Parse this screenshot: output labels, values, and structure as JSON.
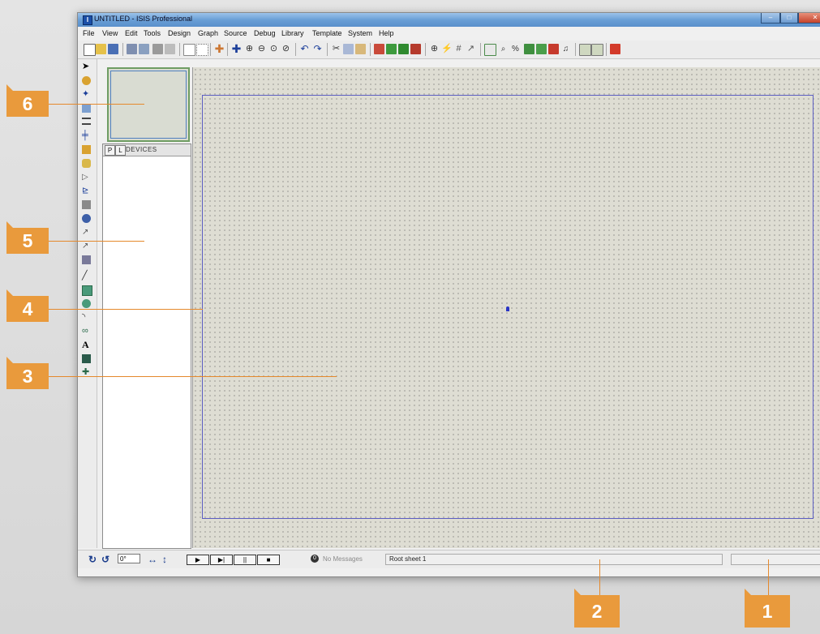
{
  "window": {
    "title": "UNTITLED - ISIS Professional",
    "icon_label": "I"
  },
  "menu": [
    "File",
    "View",
    "Edit",
    "Tools",
    "Design",
    "Graph",
    "Source",
    "Debug",
    "Library",
    "Template",
    "System",
    "Help"
  ],
  "selector": {
    "p_label": "P",
    "l_label": "L",
    "devices_label": "DEVICES"
  },
  "status": {
    "angle_value": "0°",
    "rotate_cw": "↻",
    "rotate_ccw": "↺",
    "mirror_h": "↔",
    "mirror_v": "↕",
    "play": "▶",
    "step": "▶|",
    "pause": "||",
    "stop": "■",
    "message_icon": "0",
    "messages": "No Messages",
    "sheet": "Root sheet 1"
  },
  "callouts": [
    "6",
    "5",
    "4",
    "3",
    "2",
    "1"
  ],
  "colors": {
    "callout": "#e99a3c",
    "sheet_border": "#5c5ec2",
    "grid_bg": "#deddd3"
  }
}
